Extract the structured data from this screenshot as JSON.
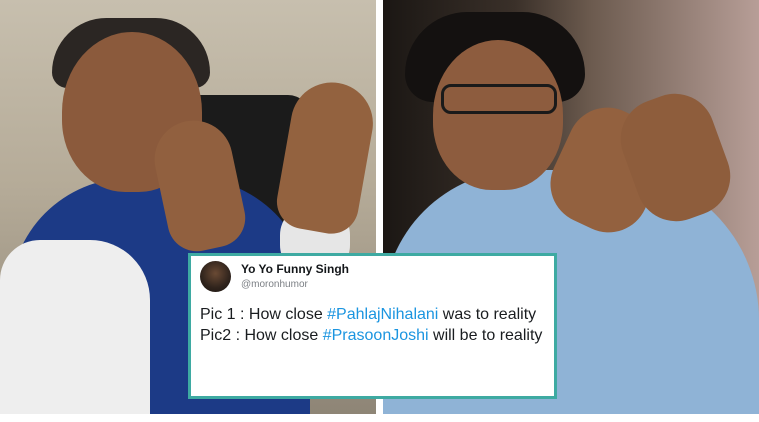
{
  "photos": {
    "left": "photo-of-man-in-blue-vest-gesturing",
    "right": "photo-of-man-in-glasses-and-blue-shirt-steepled-hands"
  },
  "tweet": {
    "display_name": "Yo Yo Funny Singh",
    "handle": "@moronhumor",
    "line1_prefix": "Pic 1 : How close ",
    "hashtag1": "#PahlajNihalani",
    "line1_suffix": " was to reality",
    "line2_prefix": "Pic2 : How close ",
    "hashtag2": "#PrasoonJoshi",
    "line2_suffix": " will be to reality"
  },
  "colors": {
    "card_border": "#3eaaa2",
    "hashtag": "#1b95e0"
  }
}
